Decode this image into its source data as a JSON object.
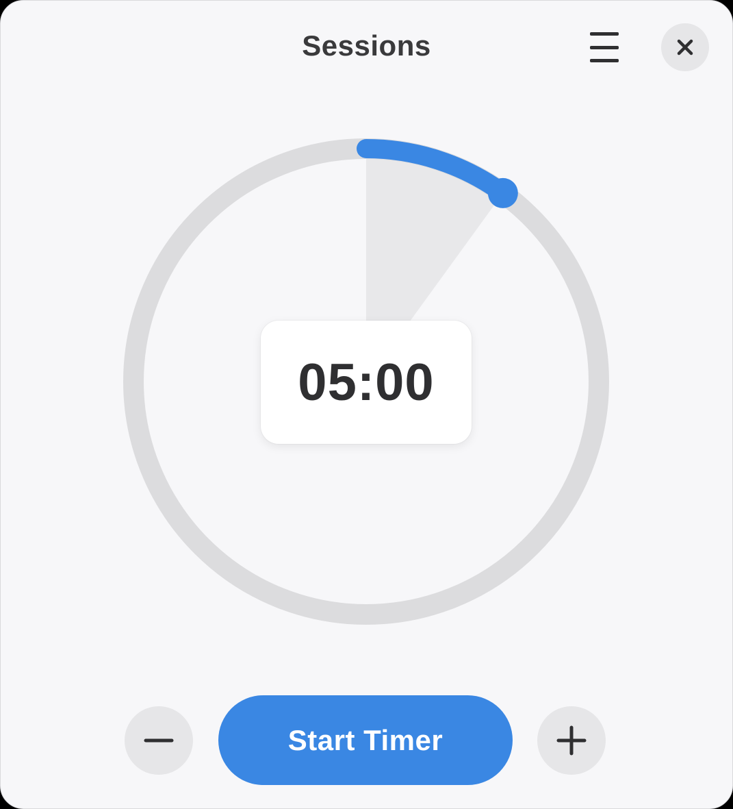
{
  "header": {
    "title": "Sessions",
    "menu_icon": "hamburger-menu-icon",
    "close_icon": "close-icon"
  },
  "timer": {
    "display": "05:00",
    "progress_fraction": 0.1,
    "progress_color": "#3a87e3",
    "track_color": "#dcdcde",
    "wedge_color": "#e8e8ea"
  },
  "controls": {
    "decrease_icon": "minus-icon",
    "start_label": "Start Timer",
    "increase_icon": "plus-icon"
  },
  "colors": {
    "accent": "#3a87e3",
    "background": "#f7f7f9",
    "button_grey": "#e6e6e8",
    "text_dark": "#2f2f31"
  }
}
